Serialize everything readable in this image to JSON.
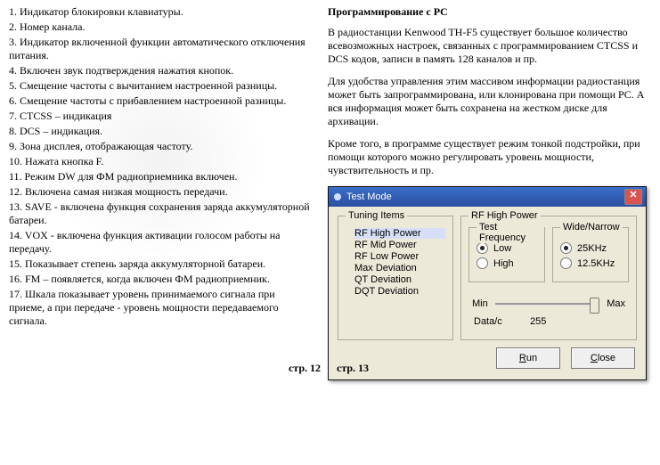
{
  "left_list": [
    "1. Индикатор блокировки клавиатуры.",
    "2. Номер канала.",
    "3. Индикатор включенной функции автоматического отключения питания.",
    "4. Включен звук подтверждения нажатия кнопок.",
    "5. Смещение частоты с вычитанием настроенной разницы.",
    "6. Смещение частоты с прибавлением настроенной разницы.",
    "7. CTCSS – индикация",
    "8. DCS – индикация.",
    "9. Зона дисплея, отображающая частоту.",
    "10. Нажата кнопка F.",
    "11. Режим DW для ФМ радиоприемника включен.",
    "12. Включена самая низкая мощность передачи.",
    "13. SAVE - включена функция сохранения заряда аккумуляторной батареи.",
    "14. VOX - включена функция активации голосом работы на передачу.",
    "15. Показывает степень заряда аккумуляторной батареи.",
    "16. FM – появляется, когда включен ФМ радиоприемник.",
    "17. Шкала показывает уровень принимаемого сигнала при приеме, а при передаче - уровень мощности передаваемого сигнала."
  ],
  "right": {
    "heading": "Программирование с PC",
    "p1": "В радиостанции Kenwood TH-F5 существует большое количество всевозможных настроек, связанных с программированием CTCSS и DCS кодов, записи в память 128 каналов и пр.",
    "p2": "Для удобства управления этим массивом информации радиостанция может быть запрограммирована, или клонирована при помощи PC. А вся информация может быть сохранена на жестком диске для архивации.",
    "p3": "Кроме того, в программе существует режим тонкой подстройки, при помощи которого можно регулировать уровень мощности, чувствительность и пр."
  },
  "dialog": {
    "title": "Test Mode",
    "tuning_legend": "Tuning Items",
    "tuning_items": [
      "RF High Power",
      "RF Mid Power",
      "RF Low Power",
      "Max Deviation",
      "QT Deviation",
      "DQT Deviation"
    ],
    "rf_legend": "RF High Power",
    "testfreq_legend": "Test Frequency",
    "widenarrow_legend": "Wide/Narrow",
    "opt_low": "Low",
    "opt_high": "High",
    "opt_25": "25KHz",
    "opt_125": "12.5KHz",
    "min_label": "Min",
    "max_label": "Max",
    "data_label": "Data/c",
    "data_value": "255",
    "btn_run_u": "R",
    "btn_run_rest": "un",
    "btn_close_u": "C",
    "btn_close_rest": "lose"
  },
  "pagenum_left": "стр. 12",
  "pagenum_right": "стр. 13"
}
